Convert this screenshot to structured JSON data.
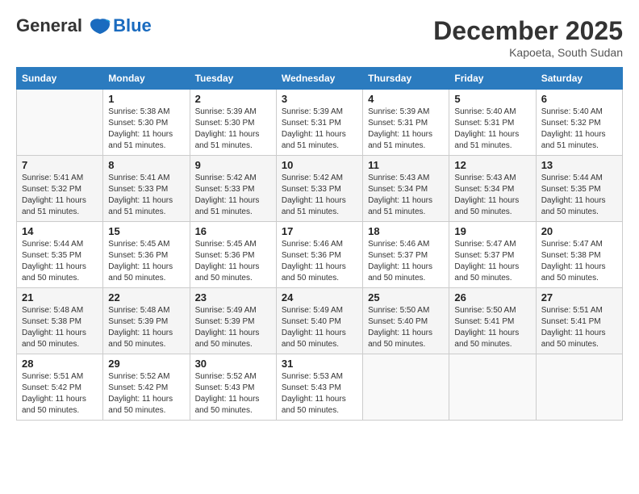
{
  "header": {
    "logo_line1": "General",
    "logo_line2": "Blue",
    "month": "December 2025",
    "location": "Kapoeta, South Sudan"
  },
  "days_of_week": [
    "Sunday",
    "Monday",
    "Tuesday",
    "Wednesday",
    "Thursday",
    "Friday",
    "Saturday"
  ],
  "weeks": [
    [
      {
        "num": "",
        "info": ""
      },
      {
        "num": "1",
        "info": "Sunrise: 5:38 AM\nSunset: 5:30 PM\nDaylight: 11 hours\nand 51 minutes."
      },
      {
        "num": "2",
        "info": "Sunrise: 5:39 AM\nSunset: 5:30 PM\nDaylight: 11 hours\nand 51 minutes."
      },
      {
        "num": "3",
        "info": "Sunrise: 5:39 AM\nSunset: 5:31 PM\nDaylight: 11 hours\nand 51 minutes."
      },
      {
        "num": "4",
        "info": "Sunrise: 5:39 AM\nSunset: 5:31 PM\nDaylight: 11 hours\nand 51 minutes."
      },
      {
        "num": "5",
        "info": "Sunrise: 5:40 AM\nSunset: 5:31 PM\nDaylight: 11 hours\nand 51 minutes."
      },
      {
        "num": "6",
        "info": "Sunrise: 5:40 AM\nSunset: 5:32 PM\nDaylight: 11 hours\nand 51 minutes."
      }
    ],
    [
      {
        "num": "7",
        "info": "Sunrise: 5:41 AM\nSunset: 5:32 PM\nDaylight: 11 hours\nand 51 minutes."
      },
      {
        "num": "8",
        "info": "Sunrise: 5:41 AM\nSunset: 5:33 PM\nDaylight: 11 hours\nand 51 minutes."
      },
      {
        "num": "9",
        "info": "Sunrise: 5:42 AM\nSunset: 5:33 PM\nDaylight: 11 hours\nand 51 minutes."
      },
      {
        "num": "10",
        "info": "Sunrise: 5:42 AM\nSunset: 5:33 PM\nDaylight: 11 hours\nand 51 minutes."
      },
      {
        "num": "11",
        "info": "Sunrise: 5:43 AM\nSunset: 5:34 PM\nDaylight: 11 hours\nand 51 minutes."
      },
      {
        "num": "12",
        "info": "Sunrise: 5:43 AM\nSunset: 5:34 PM\nDaylight: 11 hours\nand 50 minutes."
      },
      {
        "num": "13",
        "info": "Sunrise: 5:44 AM\nSunset: 5:35 PM\nDaylight: 11 hours\nand 50 minutes."
      }
    ],
    [
      {
        "num": "14",
        "info": "Sunrise: 5:44 AM\nSunset: 5:35 PM\nDaylight: 11 hours\nand 50 minutes."
      },
      {
        "num": "15",
        "info": "Sunrise: 5:45 AM\nSunset: 5:36 PM\nDaylight: 11 hours\nand 50 minutes."
      },
      {
        "num": "16",
        "info": "Sunrise: 5:45 AM\nSunset: 5:36 PM\nDaylight: 11 hours\nand 50 minutes."
      },
      {
        "num": "17",
        "info": "Sunrise: 5:46 AM\nSunset: 5:36 PM\nDaylight: 11 hours\nand 50 minutes."
      },
      {
        "num": "18",
        "info": "Sunrise: 5:46 AM\nSunset: 5:37 PM\nDaylight: 11 hours\nand 50 minutes."
      },
      {
        "num": "19",
        "info": "Sunrise: 5:47 AM\nSunset: 5:37 PM\nDaylight: 11 hours\nand 50 minutes."
      },
      {
        "num": "20",
        "info": "Sunrise: 5:47 AM\nSunset: 5:38 PM\nDaylight: 11 hours\nand 50 minutes."
      }
    ],
    [
      {
        "num": "21",
        "info": "Sunrise: 5:48 AM\nSunset: 5:38 PM\nDaylight: 11 hours\nand 50 minutes."
      },
      {
        "num": "22",
        "info": "Sunrise: 5:48 AM\nSunset: 5:39 PM\nDaylight: 11 hours\nand 50 minutes."
      },
      {
        "num": "23",
        "info": "Sunrise: 5:49 AM\nSunset: 5:39 PM\nDaylight: 11 hours\nand 50 minutes."
      },
      {
        "num": "24",
        "info": "Sunrise: 5:49 AM\nSunset: 5:40 PM\nDaylight: 11 hours\nand 50 minutes."
      },
      {
        "num": "25",
        "info": "Sunrise: 5:50 AM\nSunset: 5:40 PM\nDaylight: 11 hours\nand 50 minutes."
      },
      {
        "num": "26",
        "info": "Sunrise: 5:50 AM\nSunset: 5:41 PM\nDaylight: 11 hours\nand 50 minutes."
      },
      {
        "num": "27",
        "info": "Sunrise: 5:51 AM\nSunset: 5:41 PM\nDaylight: 11 hours\nand 50 minutes."
      }
    ],
    [
      {
        "num": "28",
        "info": "Sunrise: 5:51 AM\nSunset: 5:42 PM\nDaylight: 11 hours\nand 50 minutes."
      },
      {
        "num": "29",
        "info": "Sunrise: 5:52 AM\nSunset: 5:42 PM\nDaylight: 11 hours\nand 50 minutes."
      },
      {
        "num": "30",
        "info": "Sunrise: 5:52 AM\nSunset: 5:43 PM\nDaylight: 11 hours\nand 50 minutes."
      },
      {
        "num": "31",
        "info": "Sunrise: 5:53 AM\nSunset: 5:43 PM\nDaylight: 11 hours\nand 50 minutes."
      },
      {
        "num": "",
        "info": ""
      },
      {
        "num": "",
        "info": ""
      },
      {
        "num": "",
        "info": ""
      }
    ]
  ]
}
